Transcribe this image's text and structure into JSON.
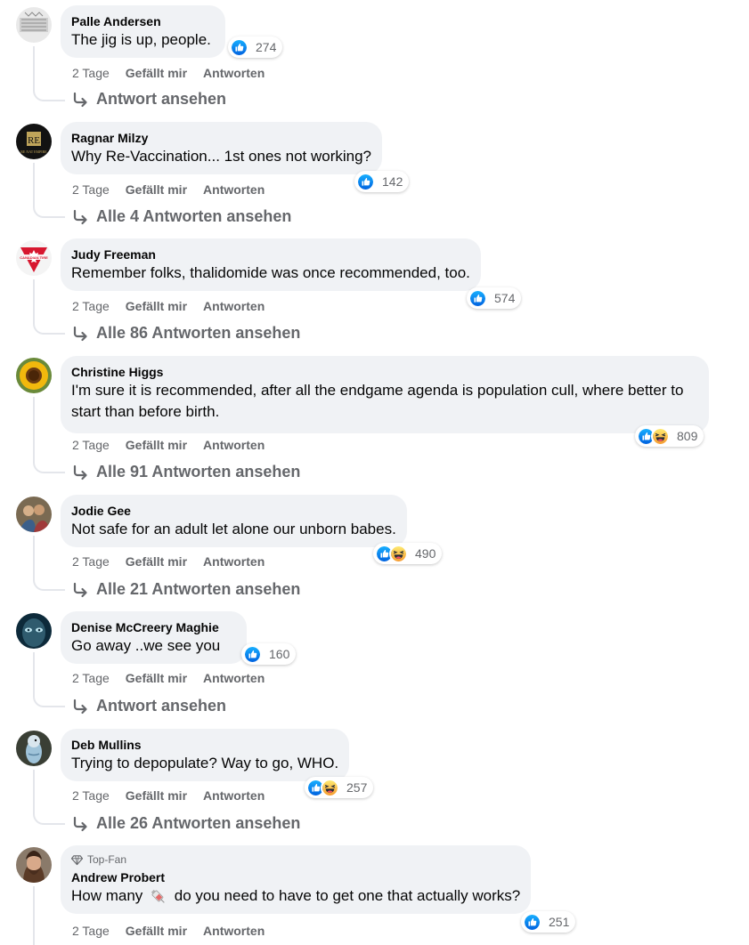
{
  "ui": {
    "like_label": "Gefällt mir",
    "reply_label": "Antworten",
    "top_fan_label": "Top-Fan"
  },
  "comments": [
    {
      "author": "Palle Andersen",
      "text": "The jig is up, people.",
      "time": "2 Tage",
      "reaction_count": "274",
      "reactions": [
        "like-icon"
      ],
      "replies_link": "Antwort ansehen"
    },
    {
      "author": "Ragnar Milzy",
      "text": "Why Re-Vaccination... 1st ones not working?",
      "time": "2 Tage",
      "reaction_count": "142",
      "reactions": [
        "like-icon"
      ],
      "replies_link": "Alle 4 Antworten ansehen"
    },
    {
      "author": "Judy Freeman",
      "text": "Remember folks, thalidomide was once recommended, too.",
      "time": "2 Tage",
      "reaction_count": "574",
      "reactions": [
        "like-icon"
      ],
      "replies_link": "Alle 86 Antworten ansehen"
    },
    {
      "author": "Christine Higgs",
      "text": "I'm sure it is recommended, after all the endgame agenda is population cull, where better to start than before birth.",
      "time": "2 Tage",
      "reaction_count": "809",
      "reactions": [
        "like-icon",
        "haha-icon"
      ],
      "replies_link": "Alle 91 Antworten ansehen"
    },
    {
      "author": "Jodie Gee",
      "text": "Not safe for an adult let alone our unborn babes.",
      "time": "2 Tage",
      "reaction_count": "490",
      "reactions": [
        "like-icon",
        "haha-icon"
      ],
      "replies_link": "Alle 21 Antworten ansehen"
    },
    {
      "author": "Denise McCreery Maghie",
      "text": "Go away ..we see you",
      "time": "2 Tage",
      "reaction_count": "160",
      "reactions": [
        "like-icon"
      ],
      "replies_link": "Antwort ansehen"
    },
    {
      "author": "Deb Mullins",
      "text": "Trying to depopulate? Way to go, WHO.",
      "time": "2 Tage",
      "reaction_count": "257",
      "reactions": [
        "like-icon",
        "haha-icon"
      ],
      "replies_link": "Alle 26 Antworten ansehen"
    },
    {
      "author": "Andrew Probert",
      "text_before": "How many",
      "text_after": "do you need to have to get one that actually works?",
      "inline_emoji": "syringe-emoji",
      "top_fan": true,
      "time": "2 Tage",
      "reaction_count": "251",
      "reactions": [
        "like-icon"
      ]
    }
  ],
  "colors": {
    "like_blue": "#1877f2",
    "haha_yellow": "#f7b125",
    "secondary_text": "#65676b",
    "bubble_bg": "#f0f2f5"
  }
}
